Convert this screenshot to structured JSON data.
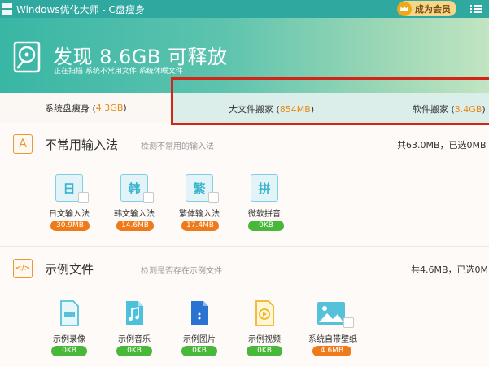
{
  "window": {
    "title": "Windows优化大师 - C盘瘦身",
    "vip_label": "成为会员"
  },
  "banner": {
    "title": "发现 8.6GB 可释放",
    "subtitle": "正在扫描  系统不常用文件  系统休眠文件"
  },
  "tabs": [
    {
      "label": "系统盘瘦身 (",
      "size": "4.3GB",
      "close": ")"
    },
    {
      "label": "大文件搬家 (",
      "size": "854MB",
      "close": ")"
    },
    {
      "label": "软件搬家 (",
      "size": "3.4GB",
      "close": ")"
    }
  ],
  "sections": [
    {
      "title": "不常用输入法",
      "desc": "检测不常用的输入法",
      "total": "共63.0MB，已选0MB",
      "icon_glyph": "A",
      "items": [
        {
          "glyph": "日",
          "label": "日文输入法",
          "size": "30.9MB",
          "badge": "orange"
        },
        {
          "glyph": "韩",
          "label": "韩文输入法",
          "size": "14.6MB",
          "badge": "orange"
        },
        {
          "glyph": "繁",
          "label": "繁体输入法",
          "size": "17.4MB",
          "badge": "orange"
        },
        {
          "glyph": "拼",
          "label": "微软拼音",
          "size": "0KB",
          "badge": "green"
        }
      ]
    },
    {
      "title": "示例文件",
      "desc": "检测是否存在示例文件",
      "total": "共4.6MB，已选0MB",
      "icon_glyph": "</>",
      "items": [
        {
          "icon": "video-file-icon",
          "label": "示例录像",
          "size": "0KB",
          "badge": "green"
        },
        {
          "icon": "music-file-icon",
          "label": "示例音乐",
          "size": "0KB",
          "badge": "green"
        },
        {
          "icon": "image-file-icon",
          "label": "示例图片",
          "size": "0KB",
          "badge": "green"
        },
        {
          "icon": "play-file-icon",
          "label": "示例视频",
          "size": "0KB",
          "badge": "green"
        },
        {
          "icon": "wallpaper-icon",
          "label": "系统自带壁纸",
          "size": "4.6MB",
          "badge": "orange"
        }
      ]
    }
  ],
  "colors": {
    "teal": "#2fa8a0",
    "accent_orange": "#e88b1a",
    "badge_orange": "#ee7a1a",
    "badge_green": "#49b83a",
    "highlight_red": "#d42418"
  }
}
